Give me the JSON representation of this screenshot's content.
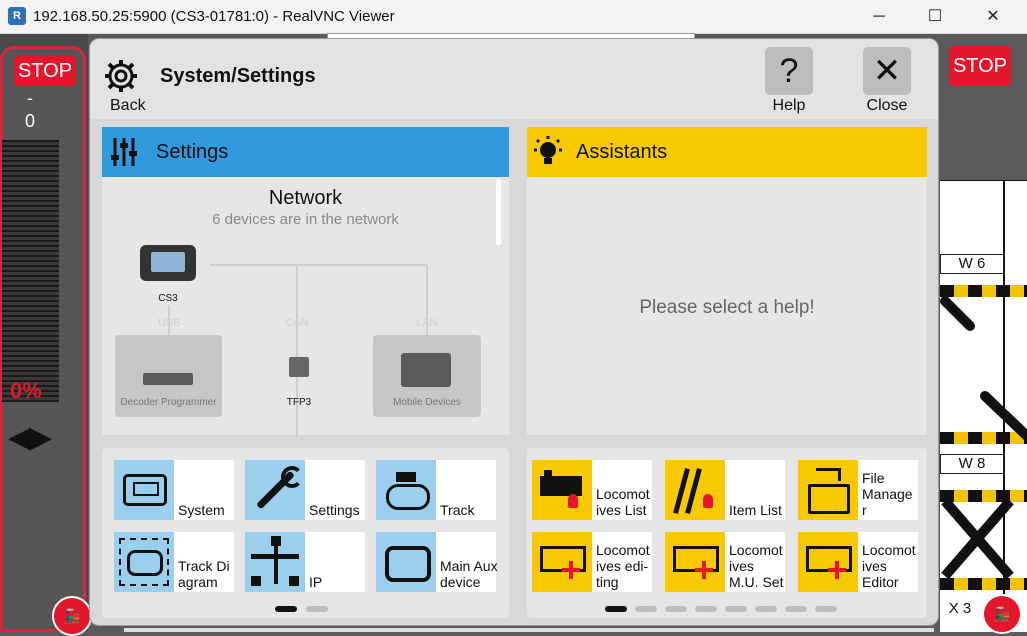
{
  "window": {
    "title": "192.168.50.25:5900 (CS3-01781:0) - RealVNC Viewer",
    "icon": "vnc-icon",
    "minimize": "─",
    "maximize": "☐",
    "close": "✕"
  },
  "background": {
    "stop_left": "STOP",
    "stop_right": "STOP",
    "speed_dash": "-",
    "speed_value": "0",
    "speed_percent": "0%",
    "direction_arrows": "◀▶",
    "track_labels": [
      "W 6",
      "W 8",
      "X 3"
    ]
  },
  "dialog": {
    "title": "System/Settings",
    "back_label": "Back",
    "help_label": "Help",
    "help_glyph": "?",
    "close_label": "Close",
    "close_glyph": "✕",
    "settings": {
      "header": "Settings",
      "network_title": "Network",
      "network_subtitle": "6 devices are in the network",
      "devices": {
        "cs3": "CS3",
        "usb": "USB",
        "can": "CAN",
        "lan": "LAN",
        "decoder": "Decoder Programmer",
        "tfp3": "TFP3",
        "mobile": "Mobile Devices"
      }
    },
    "assistants": {
      "header": "Assistants",
      "placeholder": "Please select a help!"
    },
    "left_tiles": [
      {
        "label": "System",
        "icon": "monitor-icon"
      },
      {
        "label": "Settings",
        "icon": "wrench-icon"
      },
      {
        "label": "Track",
        "icon": "track-loco-icon"
      },
      {
        "label": "Track Di agram",
        "icon": "track-diagram-icon"
      },
      {
        "label": "IP",
        "icon": "network-icon"
      },
      {
        "label": "Main Aux device",
        "icon": "aux-device-icon"
      }
    ],
    "right_tiles": [
      {
        "label": "Locomot ives List",
        "icon": "loco-list-icon"
      },
      {
        "label": "Item List",
        "icon": "item-list-icon"
      },
      {
        "label": "File Manage r",
        "icon": "file-manager-icon"
      },
      {
        "label": "Locomot ives edi- ting",
        "icon": "loco-edit-icon"
      },
      {
        "label": "Locomot ives M.U. Set",
        "icon": "loco-mu-icon"
      },
      {
        "label": "Locomot ives Editor",
        "icon": "loco-editor-icon"
      }
    ],
    "pager_left": {
      "pages": 2,
      "active": 1
    },
    "pager_right": {
      "pages": 8,
      "active": 1
    }
  },
  "colors": {
    "settings_blue": "#3399dd",
    "assist_yellow": "#f8c800",
    "stop_red": "#e3162b"
  }
}
